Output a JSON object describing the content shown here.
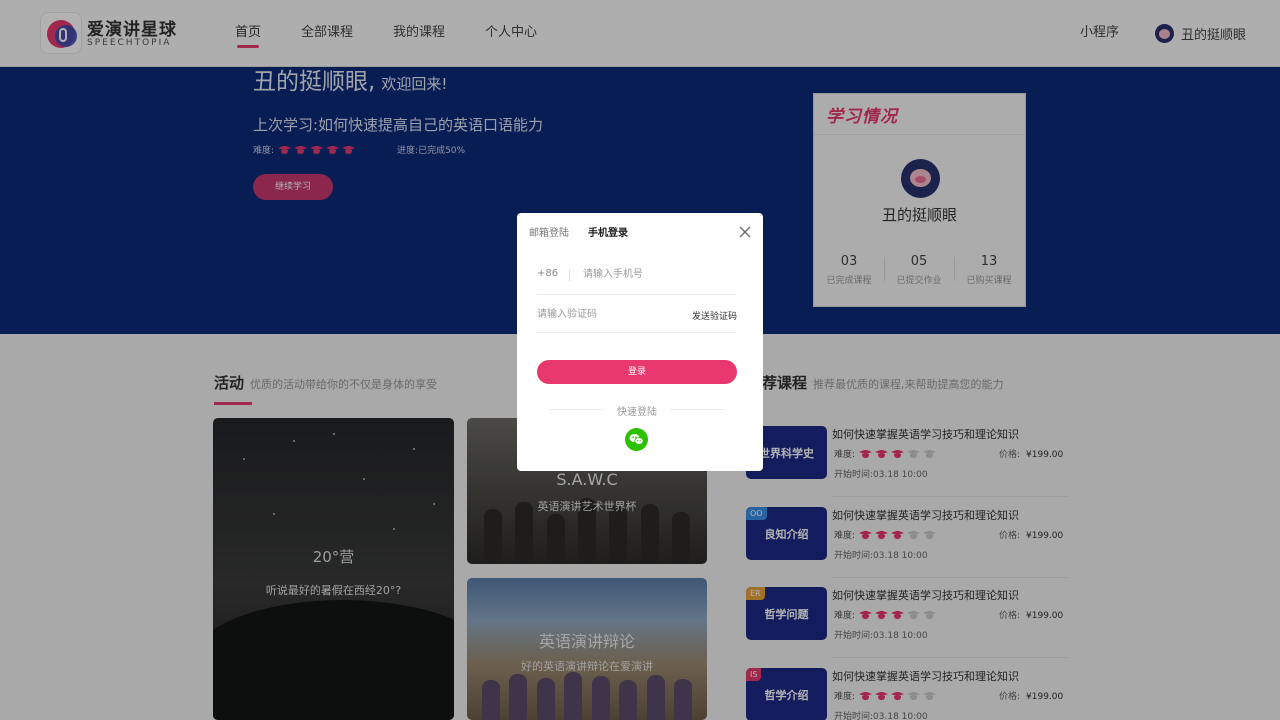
{
  "header": {
    "logo_cn": "爱演讲星球",
    "logo_en": "SPEECHTOPIA",
    "nav": [
      "首页",
      "全部课程",
      "我的课程",
      "个人中心"
    ],
    "mini_program": "小程序",
    "user_name": "丑的挺顺眼"
  },
  "hero": {
    "name": "丑的挺顺眼,",
    "welcome": "欢迎回来!",
    "last_study": "上次学习:如何快速提高自己的英语口语能力",
    "difficulty_label": "难度:",
    "difficulty_level": 5,
    "progress_label": "进度:已完成50%",
    "continue_button": "继续学习"
  },
  "study_card": {
    "title": "学习情况",
    "name": "丑的挺顺眼",
    "stats": [
      {
        "num": "03",
        "label": "已完成课程"
      },
      {
        "num": "05",
        "label": "已提交作业"
      },
      {
        "num": "13",
        "label": "已购买课程"
      }
    ]
  },
  "activity": {
    "title": "活动",
    "subtitle": "优质的活动带给你的不仅是身体的享受",
    "big": {
      "title": "20°营",
      "subtitle": "听说最好的暑假在西经20°?"
    },
    "cards": [
      {
        "title": "S.A.W.C",
        "subtitle": "英语演讲艺术世界杯"
      },
      {
        "title": "英语演讲辩论",
        "subtitle": "好的英语演讲辩论在爱演讲"
      }
    ]
  },
  "recommend": {
    "title": "荐课程",
    "subtitle": "推荐最优质的课程,来帮助提高您的能力",
    "courses": [
      {
        "thumb": "世界科学史",
        "tag": "",
        "name": "如何快速掌握英语学习技巧和理论知识",
        "difficulty_label": "难度:",
        "level": 3,
        "price_label": "价格:",
        "price": "¥199.00",
        "time": "开始时间:03.18  10:00"
      },
      {
        "thumb": "良知介绍",
        "tag": "OO",
        "name": "如何快速掌握英语学习技巧和理论知识",
        "difficulty_label": "难度:",
        "level": 3,
        "price_label": "价格:",
        "price": "¥199.00",
        "time": "开始时间:03.18  10:00"
      },
      {
        "thumb": "哲学问题",
        "tag": "ER",
        "name": "如何快速掌握英语学习技巧和理论知识",
        "difficulty_label": "难度:",
        "level": 3,
        "price_label": "价格:",
        "price": "¥199.00",
        "time": "开始时间:03.18  10:00"
      },
      {
        "thumb": "哲学介绍",
        "tag": "IS",
        "name": "如何快速掌握英语学习技巧和理论知识",
        "difficulty_label": "难度:",
        "level": 3,
        "price_label": "价格:",
        "price": "¥199.00",
        "time": "开始时间:03.18  10:00"
      }
    ]
  },
  "modal": {
    "tabs": [
      "邮箱登陆",
      "手机登录"
    ],
    "active_tab": 1,
    "country_code": "+86",
    "phone_placeholder": "请输入手机号",
    "code_placeholder": "请输入验证码",
    "send_code": "发送验证码",
    "login_button": "登录",
    "quick_login": "快速登陆"
  },
  "colors": {
    "accent": "#e8386d",
    "hero_bg": "#0d2a7a",
    "wechat": "#2dc100",
    "tag_colors": [
      "#3a8ee8",
      "#e8a33a",
      "#e8386d"
    ]
  }
}
